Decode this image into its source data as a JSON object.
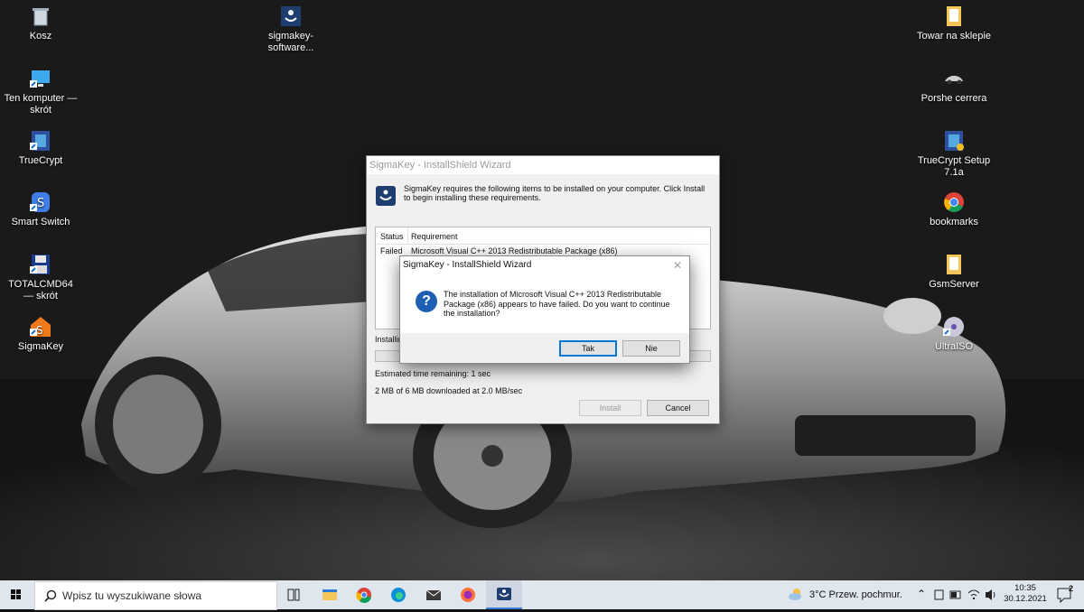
{
  "desktop": {
    "left_icons": [
      {
        "label": "Kosz"
      },
      {
        "label": "Ten komputer — skrót"
      },
      {
        "label": "TrueCrypt"
      },
      {
        "label": "Smart Switch"
      },
      {
        "label": "TOTALCMD64 — skrót"
      },
      {
        "label": "SigmaKey"
      }
    ],
    "top_icon": {
      "label": "sigmakey-software..."
    },
    "right_icons": [
      {
        "label": "Towar na sklepie"
      },
      {
        "label": "Porshe cerrera"
      },
      {
        "label": "TrueCrypt Setup 7.1a"
      },
      {
        "label": "bookmarks"
      },
      {
        "label": "GsmServer"
      },
      {
        "label": "UltraISO"
      }
    ]
  },
  "wizard": {
    "title": "SigmaKey - InstallShield Wizard",
    "description": "SigmaKey requires the following items to be installed on your computer. Click Install to begin installing these requirements.",
    "table": {
      "headers": [
        "Status",
        "Requirement"
      ],
      "rows": [
        {
          "status": "Failed",
          "requirement": "Microsoft Visual C++ 2013 Redistributable Package (x86)"
        }
      ]
    },
    "installing_label": "Installin",
    "eta": "Estimated time remaining:  1 sec",
    "downloaded": "2 MB of 6 MB downloaded at 2.0 MB/sec",
    "install_button": "Install",
    "cancel_button": "Cancel"
  },
  "dialog": {
    "title": "SigmaKey - InstallShield Wizard",
    "message": "The installation of Microsoft Visual C++ 2013 Redistributable Package (x86) appears to have failed. Do you want to continue the installation?",
    "yes_button": "Tak",
    "no_button": "Nie"
  },
  "taskbar": {
    "search_placeholder": "Wpisz tu wyszukiwane słowa",
    "weather": "3°C  Przew. pochmur.",
    "time": "10:35",
    "date": "30.12.2021",
    "notification_count": "2"
  },
  "colors": {
    "accent": "#0078d7",
    "taskbar_bg": "#dfe6ee"
  }
}
